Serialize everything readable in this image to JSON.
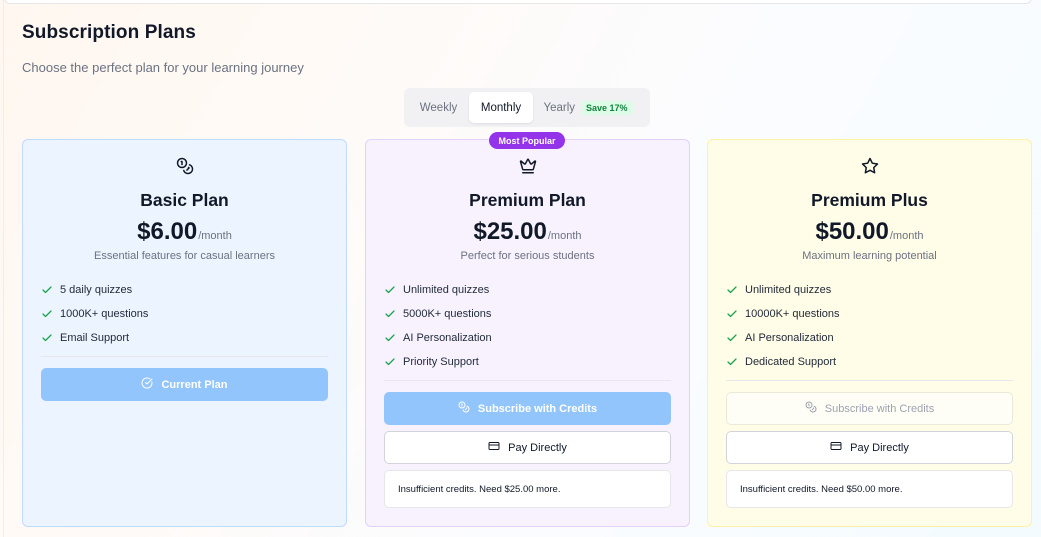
{
  "header": {
    "title": "Subscription Plans",
    "subtitle": "Choose the perfect plan for your learning journey"
  },
  "billing_toggle": {
    "options": [
      {
        "label": "Weekly",
        "selected": false
      },
      {
        "label": "Monthly",
        "selected": true
      },
      {
        "label": "Yearly",
        "selected": false,
        "badge": "Save 17%"
      }
    ]
  },
  "plans": [
    {
      "icon": "coins-icon",
      "name": "Basic Plan",
      "price": "$6.00",
      "period": "/month",
      "description": "Essential features for casual learners",
      "features": [
        "5 daily quizzes",
        "1000K+ questions",
        "Email Support"
      ],
      "current_label": "Current Plan",
      "accent": "#93c5fd"
    },
    {
      "icon": "crown-icon",
      "badge": "Most Popular",
      "name": "Premium Plan",
      "price": "$25.00",
      "period": "/month",
      "description": "Perfect for serious students",
      "features": [
        "Unlimited quizzes",
        "5000K+ questions",
        "AI Personalization",
        "Priority Support"
      ],
      "credits_label": "Subscribe with Credits",
      "pay_label": "Pay Directly",
      "notice": "Insufficient credits. Need $25.00 more.",
      "accent": "#9333ea"
    },
    {
      "icon": "star-icon",
      "name": "Premium Plus",
      "price": "$50.00",
      "period": "/month",
      "description": "Maximum learning potential",
      "features": [
        "Unlimited quizzes",
        "10000K+ questions",
        "AI Personalization",
        "Dedicated Support"
      ],
      "credits_label": "Subscribe with Credits",
      "pay_label": "Pay Directly",
      "notice": "Insufficient credits. Need $50.00 more.",
      "accent": "#fdf2a6"
    }
  ],
  "colors": {
    "check": "#16a34a",
    "popular_badge": "#9333ea",
    "primary_button": "#93c5fd"
  }
}
